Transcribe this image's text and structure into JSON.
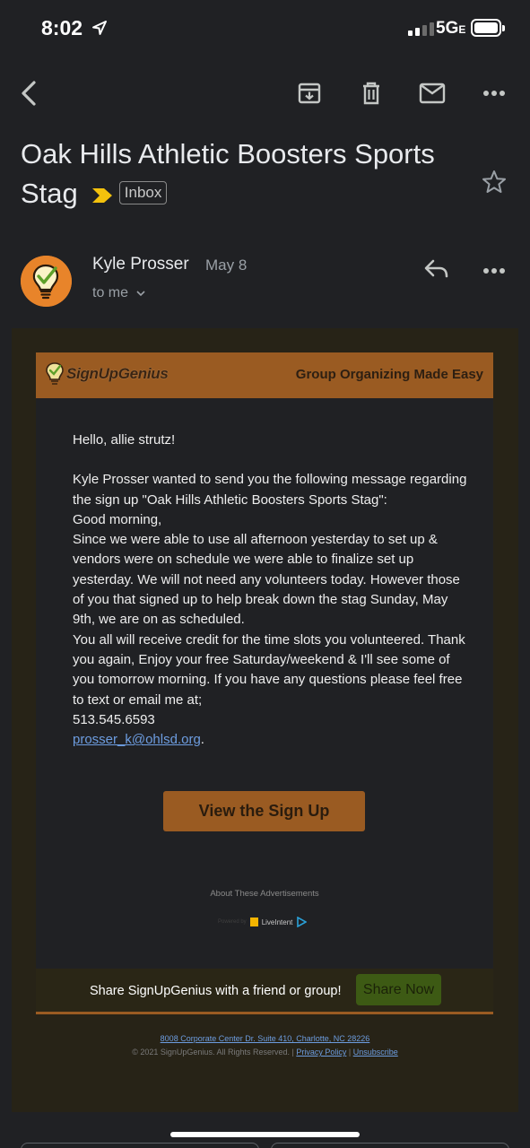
{
  "status_bar": {
    "time": "8:02",
    "network": "5G",
    "network_suffix": "E"
  },
  "toolbar": {
    "icons": [
      "back-arrow-icon",
      "archive-icon",
      "delete-icon",
      "mark-unread-icon",
      "more-icon"
    ]
  },
  "email": {
    "subject_line1": "Oak Hills Athletic Boosters Sports",
    "subject_line2": "Stag",
    "label": "Inbox",
    "sender_name": "Kyle Prosser",
    "date": "May 8",
    "recipient": "to me"
  },
  "message": {
    "brand": "SignUpGenius",
    "tagline": "Group Organizing Made Easy",
    "greeting": "Hello, allie strutz!",
    "intro": "Kyle Prosser wanted to send you the following message regarding the sign up \"Oak Hills Athletic Boosters Sports Stag\":",
    "body_lines": [
      "Good morning,",
      "Since we were able to use all afternoon yesterday to set up & vendors were on schedule we were able to finalize set up yesterday. We will not need any volunteers today. However those of you that signed up to help break down the stag Sunday, May 9th, we are on as scheduled.",
      "You all will receive credit for the time slots you volunteered. Thank you again, Enjoy your free Saturday/weekend & I'll see some of you tomorrow morning. If you have any questions please feel free to text or email me at;",
      "513.545.6593"
    ],
    "email_link": "prosser_k@ohlsd.org",
    "email_link_suffix": ".",
    "cta": "View the Sign Up",
    "about_ads": "About These Advertisements",
    "powered_by": "Powered by",
    "ad_brand": "LiveIntent",
    "share_text": "Share SignUpGenius with a friend or group!",
    "share_button": "Share Now",
    "footer_address": "8008 Corporate Center Dr. Suite 410, Charlotte, NC 28226",
    "footer_copyright": "© 2021 SignUpGenius. All Rights Reserved. |",
    "privacy": "Privacy Policy",
    "separator": "|",
    "unsubscribe": "Unsubscribe"
  },
  "colors": {
    "accent_brown": "#9a5b22",
    "importance_yellow": "#f4c20d",
    "link_blue": "#6d9de0",
    "share_green": "#3d5a14"
  }
}
